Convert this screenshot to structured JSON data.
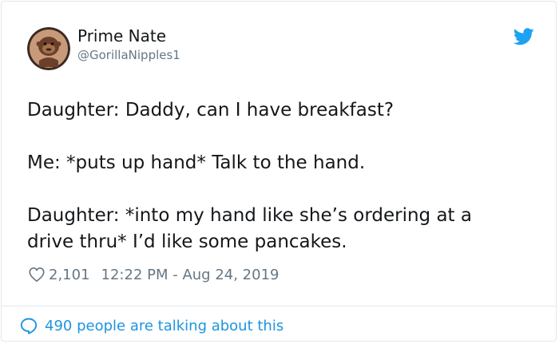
{
  "colors": {
    "brand_blue": "#1da1f2",
    "link_blue": "#1b95e0",
    "text": "#14171a",
    "muted": "#657786",
    "border": "#e1e8ed"
  },
  "icons": {
    "avatar": "gorilla-avatar",
    "brand": "twitter-bird-icon",
    "like": "heart-outline-icon",
    "reply": "speech-bubble-icon"
  },
  "author": {
    "name": "Prime Nate",
    "handle": "@GorillaNipples1"
  },
  "tweet": {
    "lines": [
      "Daughter: Daddy, can I have breakfast?",
      "Me: *puts up hand* Talk to the hand.",
      "Daughter: *into my hand like she’s ordering at a",
      "drive thru* I’d like some pancakes."
    ],
    "likes": "2,101",
    "timestamp": "12:22 PM - Aug 24, 2019"
  },
  "footer": {
    "conversation_label": "490 people are talking about this"
  }
}
